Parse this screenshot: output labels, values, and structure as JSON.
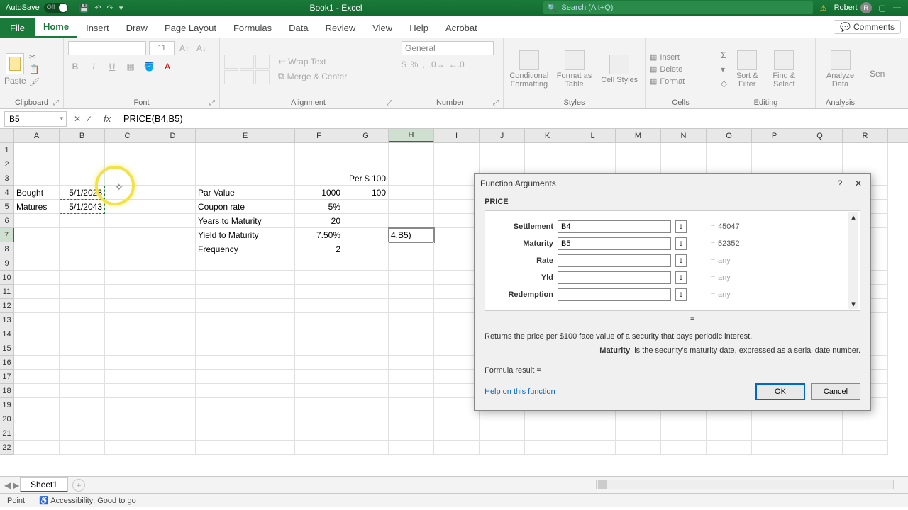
{
  "titlebar": {
    "autosave_label": "AutoSave",
    "autosave_state": "Off",
    "title": "Book1 - Excel",
    "search_placeholder": "Search (Alt+Q)",
    "user_name": "Robert",
    "user_initial": "R"
  },
  "tabs": {
    "file": "File",
    "home": "Home",
    "insert": "Insert",
    "draw": "Draw",
    "page_layout": "Page Layout",
    "formulas": "Formulas",
    "data": "Data",
    "review": "Review",
    "view": "View",
    "help": "Help",
    "acrobat": "Acrobat",
    "comments": "Comments"
  },
  "ribbon": {
    "clipboard": {
      "paste": "Paste",
      "label": "Clipboard"
    },
    "font": {
      "size": "11",
      "label": "Font"
    },
    "alignment": {
      "wrap": "Wrap Text",
      "merge": "Merge & Center",
      "label": "Alignment"
    },
    "number": {
      "format": "General",
      "label": "Number"
    },
    "styles": {
      "cf": "Conditional Formatting",
      "fat": "Format as Table",
      "cs": "Cell Styles",
      "label": "Styles"
    },
    "cells": {
      "insert": "Insert",
      "delete": "Delete",
      "format": "Format",
      "label": "Cells"
    },
    "editing": {
      "sort": "Sort & Filter",
      "find": "Find & Select",
      "label": "Editing"
    },
    "analysis": {
      "analyze": "Analyze Data",
      "label": "Analysis"
    },
    "sens": "Sen"
  },
  "fbar": {
    "namebox": "B5",
    "formula": "=PRICE(B4,B5)"
  },
  "cols": [
    "A",
    "B",
    "C",
    "D",
    "E",
    "F",
    "G",
    "H",
    "I",
    "J",
    "K",
    "L",
    "M",
    "N",
    "O",
    "P",
    "Q",
    "R"
  ],
  "cells": {
    "G3": "Per $ 100",
    "A4": "Bought",
    "B4": "5/1/2023",
    "E4": "Par Value",
    "F4": "1000",
    "G4": "100",
    "A5": "Matures",
    "B5": "5/1/2043",
    "E5": "Coupon rate",
    "F5": "5%",
    "E6": "Years to Maturity",
    "F6": "20",
    "E7": "Yield to Maturity",
    "F7": "7.50%",
    "H7": "4,B5)",
    "E8": "Frequency",
    "F8": "2"
  },
  "chart_data": {
    "type": "table",
    "inputs": {
      "bought": "5/1/2023",
      "matures": "5/1/2043",
      "par_value": 1000,
      "per_100": 100,
      "coupon_rate": 0.05,
      "years_to_maturity": 20,
      "yield_to_maturity": 0.075,
      "frequency": 2
    }
  },
  "sheets": {
    "tab1": "Sheet1"
  },
  "statusbar": {
    "mode": "Point",
    "accessibility": "Accessibility: Good to go"
  },
  "dialog": {
    "title": "Function Arguments",
    "func": "PRICE",
    "args": {
      "settlement": {
        "label": "Settlement",
        "value": "B4",
        "result": "45047"
      },
      "maturity": {
        "label": "Maturity",
        "value": "B5",
        "result": "52352"
      },
      "rate": {
        "label": "Rate",
        "value": "",
        "result": "any"
      },
      "yld": {
        "label": "Yld",
        "value": "",
        "result": "any"
      },
      "redemption": {
        "label": "Redemption",
        "value": "",
        "result": "any"
      }
    },
    "eq": "=",
    "description": "Returns the price per $100 face value of a security that pays periodic interest.",
    "arg_name": "Maturity",
    "arg_desc": "is the security's maturity date, expressed as a serial date number.",
    "formula_result": "Formula result =",
    "help_link": "Help on this function",
    "ok": "OK",
    "cancel": "Cancel"
  }
}
